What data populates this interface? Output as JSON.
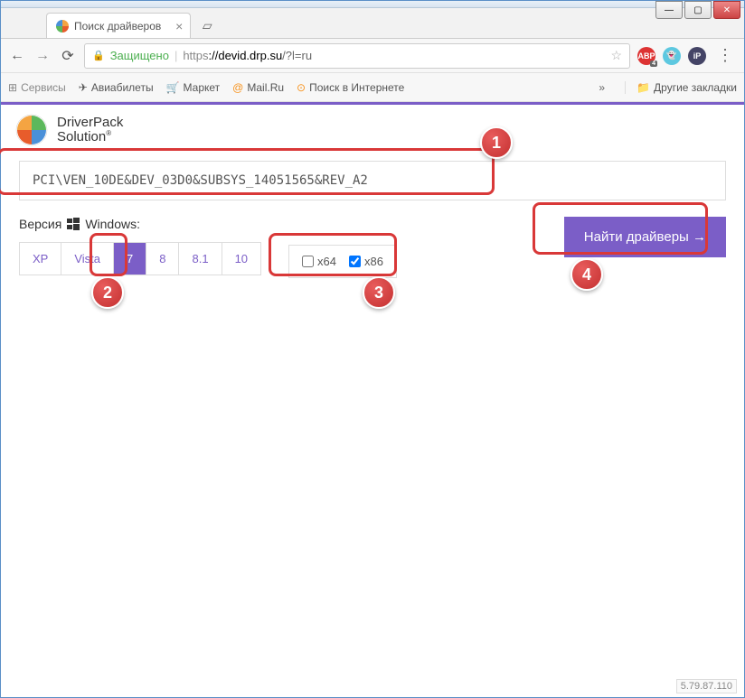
{
  "window": {
    "tab_title": "Поиск драйверов"
  },
  "address": {
    "secure_label": "Защищено",
    "proto": "https",
    "domain": "://devid.drp.su",
    "path": "/?l=ru"
  },
  "bookmarks": {
    "apps": "Сервисы",
    "items": [
      "Авиабилеты",
      "Маркет",
      "Mail.Ru",
      "Поиск в Интернете"
    ],
    "other": "Другие закладки"
  },
  "brand": {
    "line1": "DriverPack",
    "line2": "Solution",
    "reg": "®"
  },
  "search": {
    "value": "PCI\\VEN_10DE&DEV_03D0&SUBSYS_14051565&REV_A2"
  },
  "os": {
    "label": "Версия",
    "label_suffix": "Windows:",
    "tabs": [
      "XP",
      "Vista",
      "7",
      "8",
      "8.1",
      "10"
    ],
    "active_index": 2
  },
  "arch": {
    "x64": "x64",
    "x86": "x86",
    "x64_checked": false,
    "x86_checked": true
  },
  "find_button": "Найти драйверы →",
  "annotations": [
    "1",
    "2",
    "3",
    "4"
  ],
  "version": "5.79.87.110"
}
